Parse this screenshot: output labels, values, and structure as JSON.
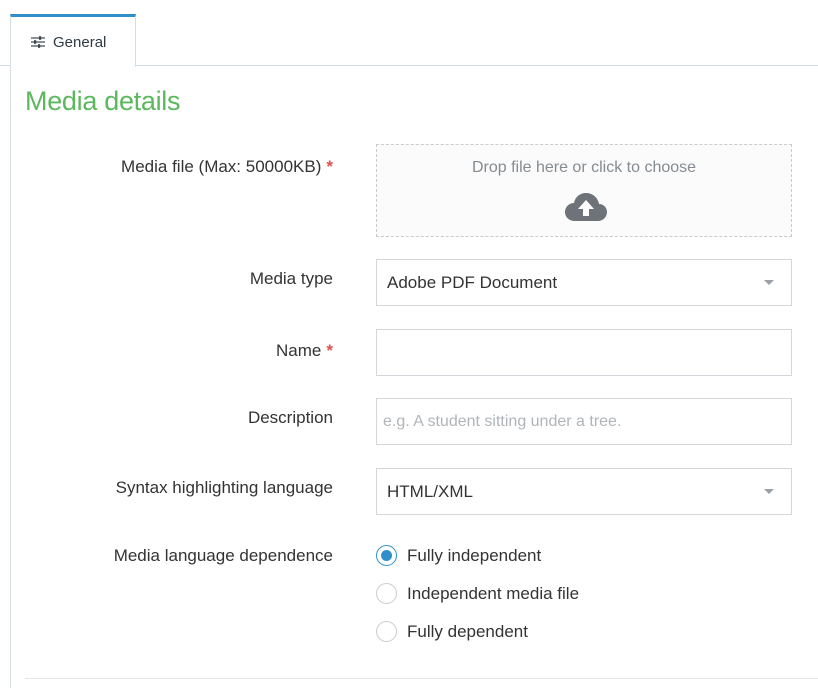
{
  "tabs": [
    {
      "label": "General",
      "icon": "sliders-icon",
      "active": true
    }
  ],
  "section": {
    "title": "Media details"
  },
  "form": {
    "media_file": {
      "label": "Media file (Max: 50000KB)",
      "required_mark": "*",
      "dropzone_text": "Drop file here or click to choose",
      "icon": "cloud-upload-icon"
    },
    "media_type": {
      "label": "Media type",
      "value": "Adobe PDF Document"
    },
    "name": {
      "label": "Name",
      "required_mark": "*",
      "value": "",
      "placeholder": ""
    },
    "description": {
      "label": "Description",
      "value": "",
      "placeholder": "e.g. A student sitting under a tree."
    },
    "syntax_language": {
      "label": "Syntax highlighting language",
      "value": "HTML/XML"
    },
    "language_dependence": {
      "label": "Media language dependence",
      "options": [
        {
          "label": "Fully independent",
          "checked": true
        },
        {
          "label": "Independent media file",
          "checked": false
        },
        {
          "label": "Fully dependent",
          "checked": false
        }
      ]
    }
  },
  "colors": {
    "accent": "#2f8fc8",
    "section_title": "#5cb85c",
    "required": "#d9534f"
  }
}
